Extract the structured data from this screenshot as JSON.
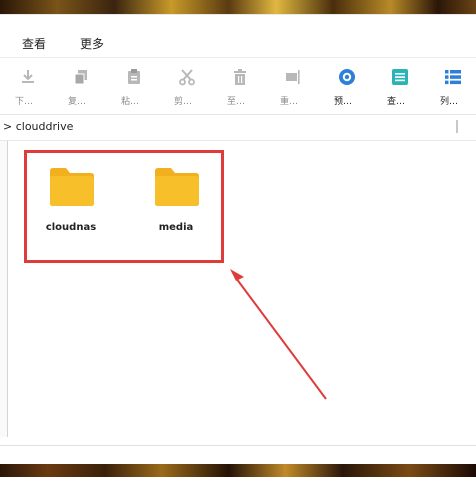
{
  "menu": {
    "items": [
      "查看",
      "更多"
    ]
  },
  "toolbar": {
    "buttons": [
      {
        "label": "下…",
        "icon": "download-icon"
      },
      {
        "label": "复…",
        "icon": "copy-icon"
      },
      {
        "label": "粘…",
        "icon": "paste-icon"
      },
      {
        "label": "剪…",
        "icon": "cut-icon"
      },
      {
        "label": "至…",
        "icon": "delete-icon"
      },
      {
        "label": "重…",
        "icon": "rename-icon"
      },
      {
        "label": "预…",
        "icon": "preview-icon"
      },
      {
        "label": "查…",
        "icon": "details-icon"
      },
      {
        "label": "列…",
        "icon": "list-view-icon"
      }
    ]
  },
  "path": {
    "text": "> clouddrive"
  },
  "files": [
    {
      "name": "cloudnas",
      "icon": "folder-icon"
    },
    {
      "name": "media",
      "icon": "folder-icon"
    }
  ],
  "colors": {
    "folder": "#f7bf2a",
    "folder_tab": "#f2b01e",
    "annotation": "#e03b3b",
    "accent_blue": "#2d7fd8",
    "accent_teal": "#2cb3b8"
  }
}
